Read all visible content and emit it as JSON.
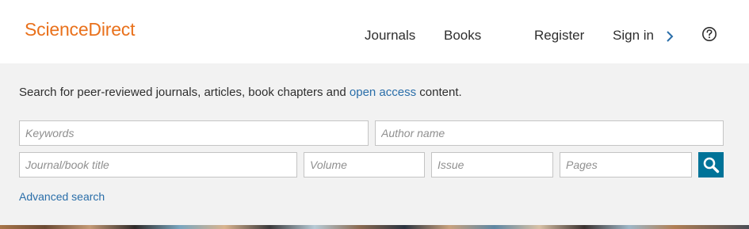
{
  "header": {
    "logo_text": "ScienceDirect",
    "nav": {
      "journals": "Journals",
      "books": "Books",
      "register": "Register",
      "sign_in": "Sign in"
    },
    "icons": {
      "sign_in_chevron": "chevron-right-icon",
      "help": "help-circle-icon"
    }
  },
  "search": {
    "intro_prefix": "Search for peer-reviewed journals, articles, book chapters and ",
    "intro_link": "open access",
    "intro_suffix": " content.",
    "placeholders": {
      "keywords": "Keywords",
      "author": "Author name",
      "journal": "Journal/book title",
      "volume": "Volume",
      "issue": "Issue",
      "pages": "Pages"
    },
    "values": {
      "keywords": "",
      "author": "",
      "journal": "",
      "volume": "",
      "issue": "",
      "pages": ""
    },
    "submit_icon": "search-icon",
    "advanced_label": "Advanced search"
  },
  "colors": {
    "brand_orange": "#e9711c",
    "link_blue": "#2a6ea9",
    "search_button": "#007398",
    "panel_background": "#f2f2f2"
  }
}
